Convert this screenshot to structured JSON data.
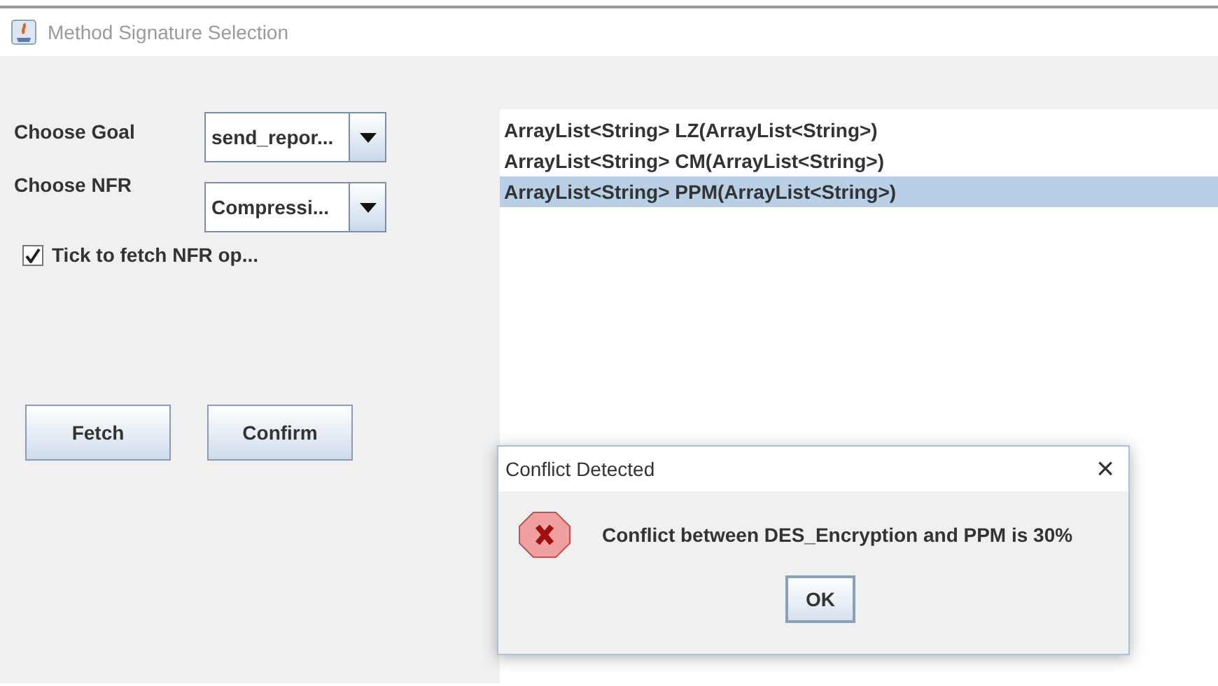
{
  "window": {
    "title": "Method Signature Selection"
  },
  "fields": [
    {
      "label": "Choose Goal",
      "value": "send_repor..."
    },
    {
      "label": "Choose NFR",
      "value": "Compressi..."
    }
  ],
  "checkbox": {
    "label": "Tick to fetch NFR op...",
    "checked": true
  },
  "buttons": [
    "Fetch",
    "Confirm"
  ],
  "methods": [
    {
      "text": "ArrayList<String> LZ(ArrayList<String>)",
      "selected": false
    },
    {
      "text": "ArrayList<String> CM(ArrayList<String>)",
      "selected": false
    },
    {
      "text": "ArrayList<String> PPM(ArrayList<String>)",
      "selected": true
    }
  ],
  "dialog": {
    "title": "Conflict Detected",
    "close": "×",
    "message": "Conflict between DES_Encryption and PPM is 30%",
    "button": "OK"
  }
}
